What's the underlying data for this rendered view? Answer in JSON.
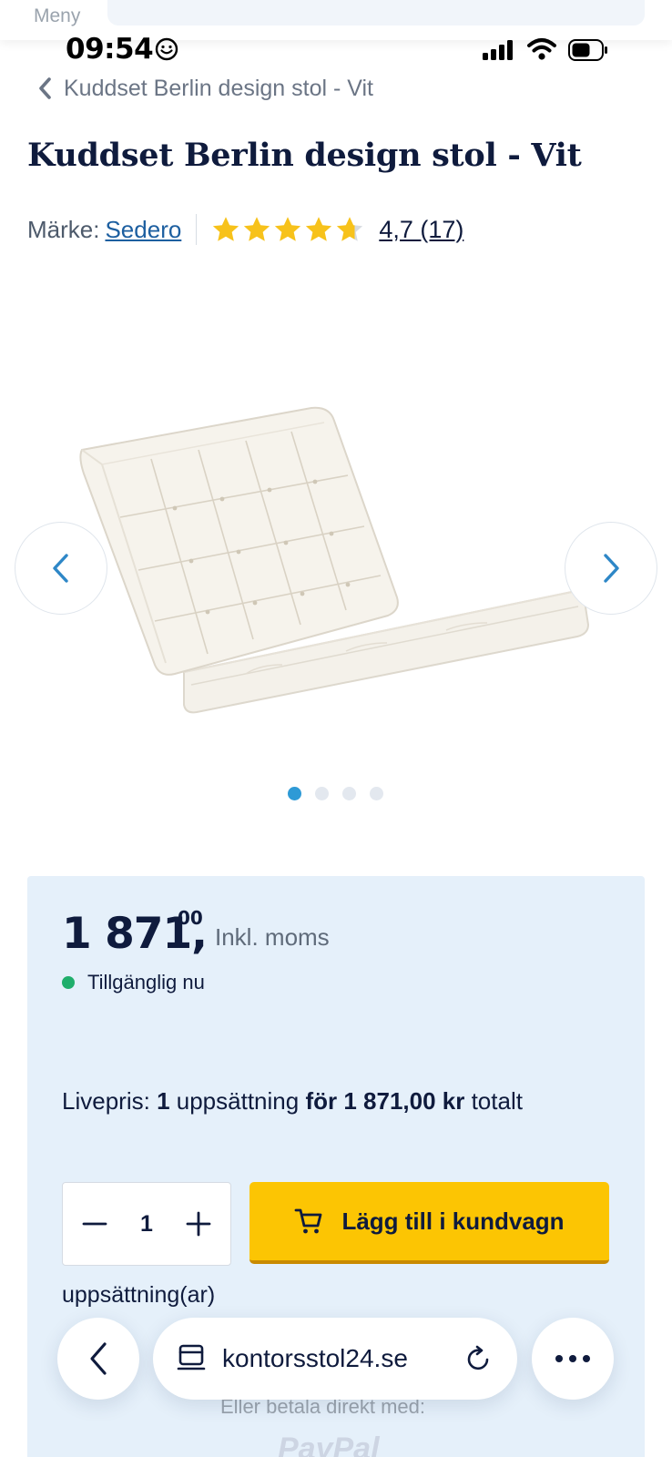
{
  "top": {
    "menu_label": "Meny"
  },
  "status_bar": {
    "time": "09:54"
  },
  "breadcrumb": {
    "label": "Kuddset Berlin design stol - Vit"
  },
  "product": {
    "title": "Kuddset Berlin design stol - Vit",
    "brand_prefix": "Märke:",
    "brand_name": "Sedero",
    "rating_text": "4,7 (17)",
    "rating_value": 4.7,
    "rating_max": 5,
    "image_icon": "cushion-set-image",
    "carousel": {
      "total": 4,
      "active": 1
    }
  },
  "buy_box": {
    "price_main": "1 871,",
    "price_decimals": "00",
    "price_note": "Inkl. moms",
    "availability": "Tillgänglig nu",
    "live_prefix": "Livepris:",
    "live_qty": "1",
    "live_unit": "uppsättning",
    "live_price": "för 1 871,00 kr",
    "live_suffix": "totalt",
    "quantity": "1",
    "add_to_cart_label": "Lägg till i kundvagn",
    "unit_label": "uppsättning(ar)",
    "pay_direct_label": "Eller betala direkt med:",
    "paypal_label": "PayPal"
  },
  "browser": {
    "url": "kontorsstol24.se"
  },
  "colors": {
    "accent": "#fcc503",
    "link": "#1d5fa0",
    "panel": "#e5f0fa",
    "available": "#1fae6b",
    "dot_active": "#2e9ad6"
  }
}
